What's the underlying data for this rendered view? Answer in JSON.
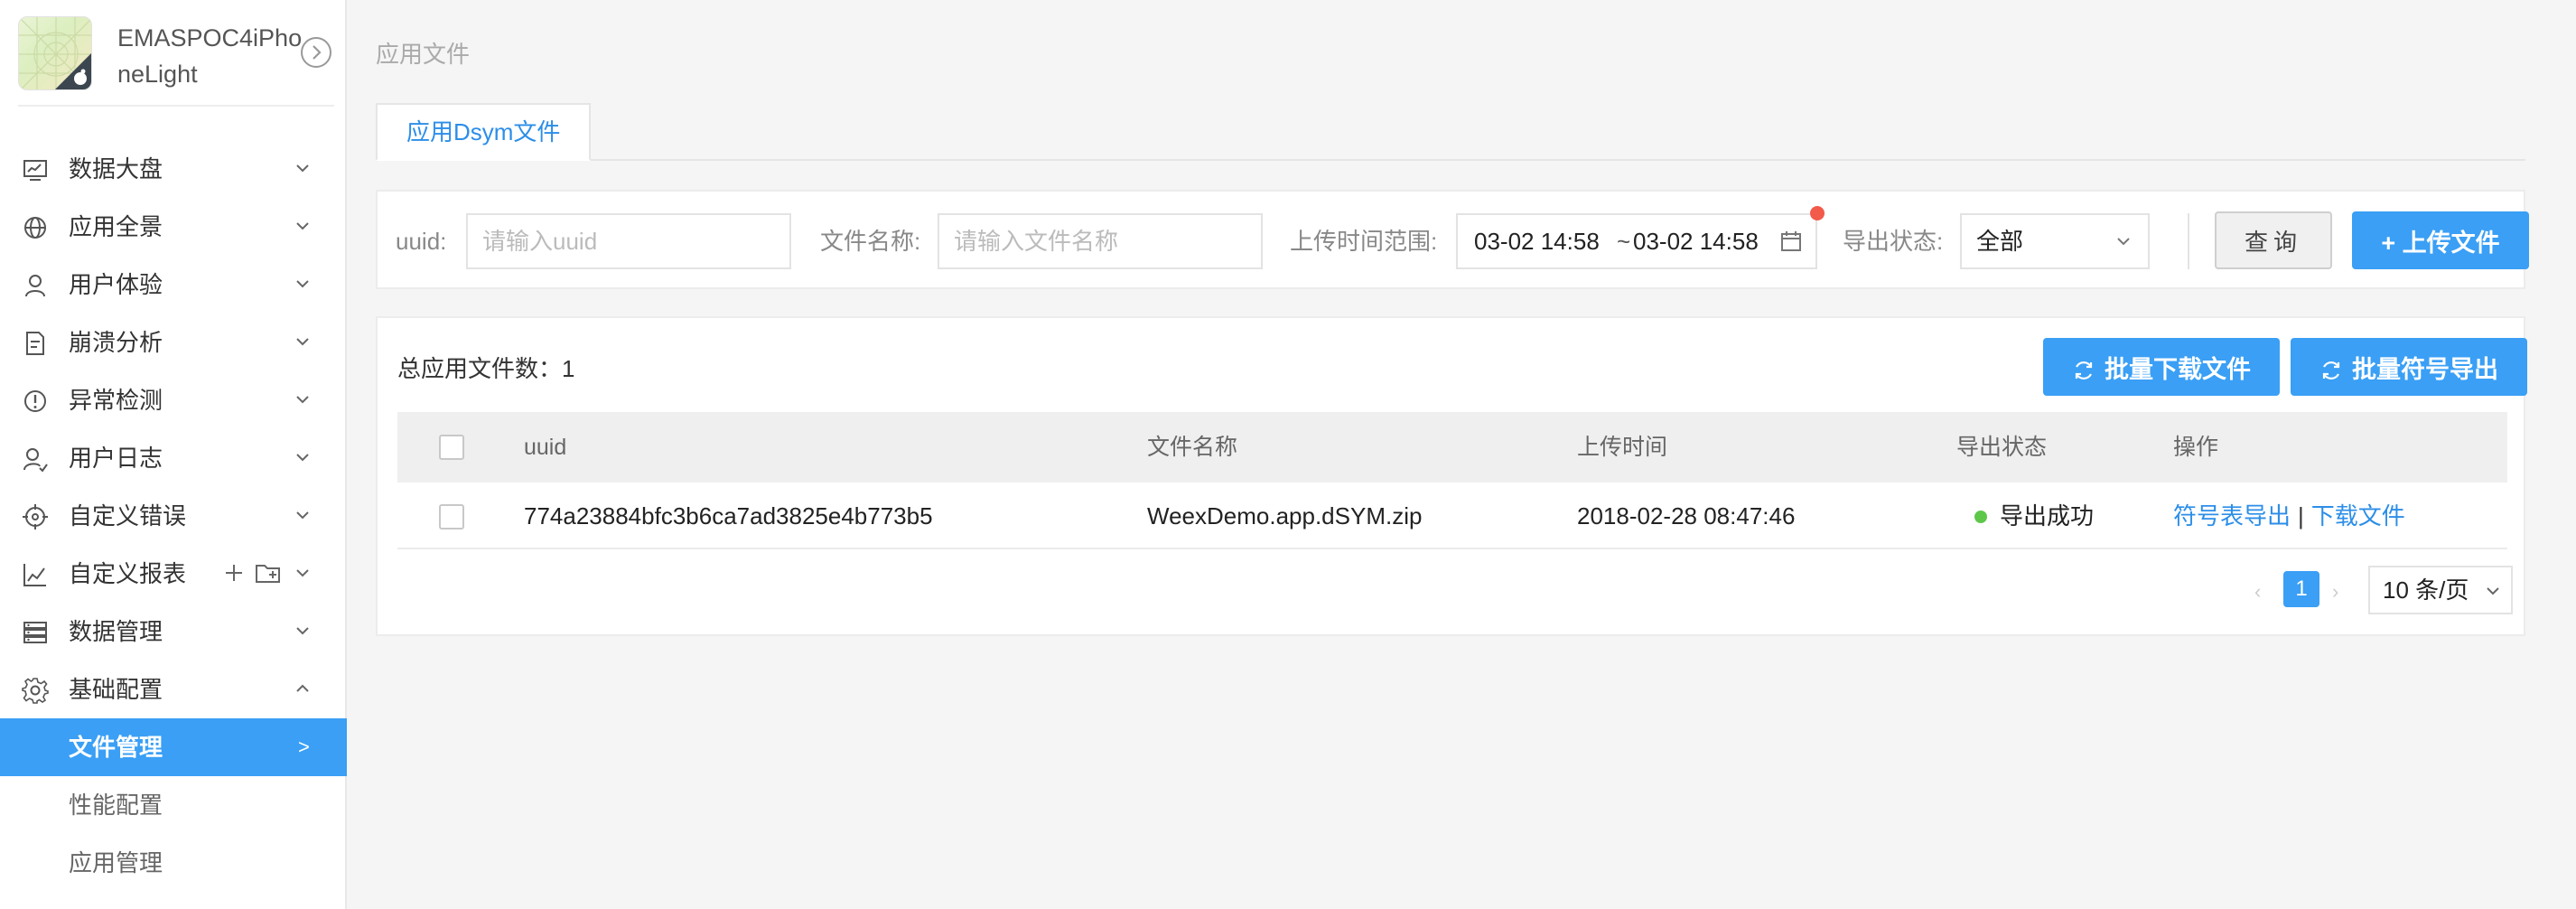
{
  "app": {
    "name": "EMASPOC4iPhoneLight"
  },
  "sidebar": {
    "items": [
      {
        "label": "数据大盘",
        "icon": "dashboard-icon",
        "expanded": false
      },
      {
        "label": "应用全景",
        "icon": "globe-icon",
        "expanded": false
      },
      {
        "label": "用户体验",
        "icon": "user-icon",
        "expanded": false
      },
      {
        "label": "崩溃分析",
        "icon": "crash-report-icon",
        "expanded": false
      },
      {
        "label": "异常检测",
        "icon": "alert-icon",
        "expanded": false
      },
      {
        "label": "用户日志",
        "icon": "user-log-icon",
        "expanded": false
      },
      {
        "label": "自定义错误",
        "icon": "target-icon",
        "expanded": false
      },
      {
        "label": "自定义报表",
        "icon": "line-chart-icon",
        "expanded": false
      },
      {
        "label": "数据管理",
        "icon": "database-icon",
        "expanded": false
      },
      {
        "label": "基础配置",
        "icon": "settings-icon",
        "expanded": true
      }
    ],
    "subitems": [
      {
        "label": "文件管理",
        "active": true,
        "chevron": ">"
      },
      {
        "label": "性能配置",
        "active": false
      },
      {
        "label": "应用管理",
        "active": false
      }
    ]
  },
  "main": {
    "breadcrumb": "应用文件",
    "tabs": [
      {
        "label": "应用Dsym文件",
        "active": true
      }
    ],
    "filters": {
      "uuid_label": "uuid:",
      "uuid_placeholder": "请输入uuid",
      "uuid_value": "",
      "filename_label": "文件名称:",
      "filename_placeholder": "请输入文件名称",
      "filename_value": "",
      "time_range_label": "上传时间范围:",
      "time_start": "03-02 14:58",
      "time_sep": "~",
      "time_end": "03-02 14:58",
      "status_label": "导出状态:",
      "status_value": "全部",
      "query_button": "查询",
      "upload_button": "+ 上传文件"
    },
    "table": {
      "total_label": "总应用文件数：1",
      "batch_download_button": "批量下载文件",
      "batch_export_button": "批量符号导出",
      "columns": [
        "uuid",
        "文件名称",
        "上传时间",
        "导出状态",
        "操作"
      ],
      "rows": [
        {
          "uuid": "774a23884bfc3b6ca7ad3825e4b773b5",
          "filename": "WeexDemo.app.dSYM.zip",
          "upload_time": "2018-02-28 08:47:46",
          "status": "导出成功",
          "status_color": "#5ec74a",
          "action_export": "符号表导出",
          "action_sep": "|",
          "action_download": "下载文件"
        }
      ]
    },
    "pagination": {
      "current_page": "1",
      "page_size": "10 条/页"
    }
  },
  "colors": {
    "primary": "#3a9ff5",
    "link": "#2c8ee8",
    "success": "#5ec74a",
    "notice": "#f25a4a"
  }
}
